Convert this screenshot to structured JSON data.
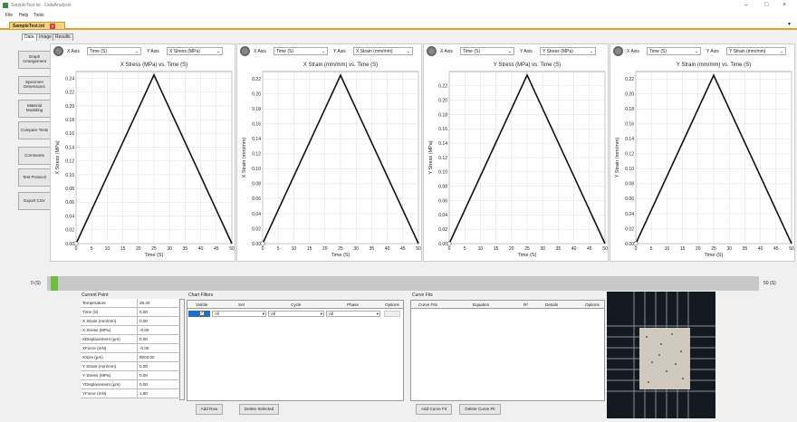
{
  "window": {
    "title": "SampleTest.txt - DataAnalysis"
  },
  "menu": [
    "File",
    "Help",
    "Tools"
  ],
  "doc_tab": "SampleTest.txt",
  "sub_tabs": [
    "Data",
    "Image",
    "Results"
  ],
  "nav": [
    "Graph Arrangement",
    "Specimen Dimensions",
    "Material Modeling",
    "Compare Tests",
    "Comments",
    "Test Protocol",
    "Export CSV"
  ],
  "axis": {
    "x_label": "X Axis",
    "y_label": "Y Axis"
  },
  "charts": [
    {
      "x_axis": "Time (S)",
      "y_axis": "X Stress (MPa)",
      "title": "X Stress (MPa) vs. Time (S)",
      "xlabel": "Time (S)",
      "ylabel": "X Stress (MPa)",
      "yticks": [
        "0.00",
        "0.02",
        "0.04",
        "0.06",
        "0.08",
        "0.10",
        "0.12",
        "0.14",
        "0.16",
        "0.18",
        "0.20",
        "0.22",
        "0.24"
      ]
    },
    {
      "x_axis": "Time (S)",
      "y_axis": "X Strain (mm/mm)",
      "title": "X Strain (mm/mm) vs. Time (S)",
      "xlabel": "Time (S)",
      "ylabel": "X Strain (mm/mm)",
      "yticks": [
        "0.00",
        "0.02",
        "0.04",
        "0.06",
        "0.08",
        "0.10",
        "0.12",
        "0.14",
        "0.16",
        "0.18",
        "0.20",
        "0.22"
      ]
    },
    {
      "x_axis": "Time (S)",
      "y_axis": "Y Stress (MPa)",
      "title": "Y Stress (MPa) vs. Time (S)",
      "xlabel": "Time (S)",
      "ylabel": "Y Stress (MPa)",
      "yticks": [
        "0.00",
        "0.02",
        "0.04",
        "0.06",
        "0.08",
        "0.10",
        "0.12",
        "0.14",
        "0.16",
        "0.18",
        "0.20",
        "0.22"
      ]
    },
    {
      "x_axis": "Time (S)",
      "y_axis": "Y Strain (mm/mm)",
      "title": "Y Strain (mm/mm) vs. Time (S)",
      "xlabel": "Time (S)",
      "ylabel": "Y Strain (mm/mm)",
      "yticks": [
        "0.00",
        "0.02",
        "0.04",
        "0.06",
        "0.08",
        "0.10",
        "0.12",
        "0.14",
        "0.16",
        "0.18",
        "0.20",
        "0.22"
      ]
    }
  ],
  "chart_data": [
    {
      "type": "line",
      "title": "X Stress (MPa) vs. Time (S)",
      "xlabel": "Time (S)",
      "ylabel": "X Stress (MPa)",
      "xlim": [
        0,
        50
      ],
      "ylim": [
        0,
        0.25
      ],
      "x": [
        0,
        25,
        50
      ],
      "y": [
        0,
        0.245,
        0
      ]
    },
    {
      "type": "line",
      "title": "X Strain (mm/mm) vs. Time (S)",
      "xlabel": "Time (S)",
      "ylabel": "X Strain (mm/mm)",
      "xlim": [
        0,
        50
      ],
      "ylim": [
        0,
        0.23
      ],
      "x": [
        0,
        25,
        50
      ],
      "y": [
        0,
        0.225,
        0
      ]
    },
    {
      "type": "line",
      "title": "Y Stress (MPa) vs. Time (S)",
      "xlabel": "Time (S)",
      "ylabel": "Y Stress (MPa)",
      "xlim": [
        0,
        50
      ],
      "ylim": [
        0,
        0.24
      ],
      "x": [
        0,
        25,
        50
      ],
      "y": [
        0,
        0.235,
        0
      ]
    },
    {
      "type": "line",
      "title": "Y Strain (mm/mm) vs. Time (S)",
      "xlabel": "Time (S)",
      "ylabel": "Y Strain (mm/mm)",
      "xlim": [
        0,
        50
      ],
      "ylim": [
        0,
        0.23
      ],
      "x": [
        0,
        25,
        50
      ],
      "y": [
        0,
        0.225,
        0
      ]
    }
  ],
  "xticks": [
    "0",
    "5",
    "10",
    "15",
    "20",
    "25",
    "30",
    "35",
    "40",
    "45",
    "50"
  ],
  "slider": {
    "left": "0 (S)",
    "right": "50 (S)"
  },
  "current_point": {
    "title": "Current Point",
    "rows": [
      [
        "Temperature",
        "26.40"
      ],
      [
        "Time (S)",
        "0.00"
      ],
      [
        "X Strain (mm/mm)",
        "0.00"
      ],
      [
        "X Stress (MPa)",
        "-0.00"
      ],
      [
        "XDisplacement (µm)",
        "0.00"
      ],
      [
        "XForce (mN)",
        "-0.00"
      ],
      [
        "XSize (µm)",
        "8003.00"
      ],
      [
        "Y Strain (mm/mm)",
        "0.00"
      ],
      [
        "Y Stress (MPa)",
        "0.00"
      ],
      [
        "YDisplacement (µm)",
        "0.00"
      ],
      [
        "YForce (mN)",
        "1.80"
      ]
    ]
  },
  "chart_filters": {
    "title": "Chart Filters",
    "headers": [
      "Visible",
      "Set",
      "Cycle",
      "Phase",
      "Options"
    ],
    "set": "All",
    "cycle": "All",
    "phase": "All",
    "add_row": "Add Row",
    "delete_selected": "Delete Selected"
  },
  "curve_fits": {
    "title": "Curve Fits",
    "headers": [
      "Curve Fits",
      "Equation",
      "R²",
      "Details",
      "Options"
    ],
    "add": "Add Curve Fit",
    "delete": "Delete Curve Fit"
  }
}
